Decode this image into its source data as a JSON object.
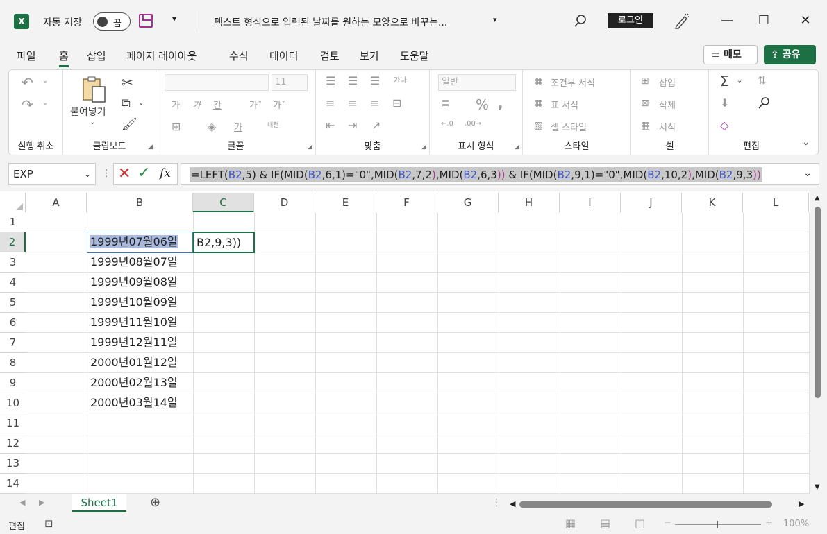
{
  "app": {
    "autosave_label": "자동 저장",
    "autosave_state": "끔",
    "doc_title": "텍스트 형식으로 입력된 날짜를 원하는 모양으로 바꾸는...",
    "login_label": "로그인"
  },
  "menu": {
    "items": [
      "파일",
      "홈",
      "삽입",
      "페이지 레이아웃",
      "수식",
      "데이터",
      "검토",
      "보기",
      "도움말"
    ],
    "active": "홈",
    "memo_label": "메모",
    "share_label": "공유"
  },
  "ribbon": {
    "undo_label": "실행 취소",
    "paste_label": "붙여넣기",
    "clipboard_label": "클립보드",
    "font_label": "글꼴",
    "font_size": "11",
    "align_label": "맞춤",
    "number_format": "일반",
    "number_label": "표시 형식",
    "cond_format": "조건부 서식",
    "table_format": "표 서식",
    "cell_style": "셀 스타일",
    "style_label": "스타일",
    "insert": "삽입",
    "delete": "삭제",
    "format": "서식",
    "cells_label": "셀",
    "edit_label": "편집"
  },
  "formula_bar": {
    "name_box": "EXP",
    "fx": "fx",
    "formula_parts": [
      {
        "t": "=LEFT(",
        "c": ""
      },
      {
        "t": "B2",
        "c": "ref"
      },
      {
        "t": ",5) & IF(MID(",
        "c": ""
      },
      {
        "t": "B2",
        "c": "ref"
      },
      {
        "t": ",6,1)=\"0\",MID(",
        "c": ""
      },
      {
        "t": "B2",
        "c": "ref"
      },
      {
        "t": ",7,2",
        "c": ""
      },
      {
        "t": ")",
        "c": "paren"
      },
      {
        "t": ",MID(",
        "c": ""
      },
      {
        "t": "B2",
        "c": "ref"
      },
      {
        "t": ",6,3",
        "c": ""
      },
      {
        "t": "))",
        "c": "paren"
      },
      {
        "t": " & IF(MID(",
        "c": ""
      },
      {
        "t": "B2",
        "c": "ref"
      },
      {
        "t": ",9,1)=\"0\",MID(",
        "c": ""
      },
      {
        "t": "B2",
        "c": "ref"
      },
      {
        "t": ",10,2",
        "c": ""
      },
      {
        "t": ")",
        "c": "paren"
      },
      {
        "t": ",MID(",
        "c": ""
      },
      {
        "t": "B2",
        "c": "ref"
      },
      {
        "t": ",9,3",
        "c": ""
      },
      {
        "t": "))",
        "c": "paren"
      }
    ]
  },
  "grid": {
    "columns": [
      "A",
      "B",
      "C",
      "D",
      "E",
      "F",
      "G",
      "H",
      "I",
      "J",
      "K",
      "L"
    ],
    "rows": [
      "1",
      "2",
      "3",
      "4",
      "5",
      "6",
      "7",
      "8",
      "9",
      "10",
      "11",
      "12",
      "13",
      "14"
    ],
    "col_b_values": [
      "",
      "1999년07월06일",
      "1999년08월07일",
      "1999년09월08일",
      "1999년10월09일",
      "1999년11월10일",
      "1999년12월11일",
      "2000년01월12일",
      "2000년02월13일",
      "2000년03월14일"
    ],
    "c2_edit_text": "B2,9,3))"
  },
  "sheets": {
    "tabs": [
      "Sheet1"
    ]
  },
  "status": {
    "mode": "편집",
    "zoom": "100%"
  },
  "colors": {
    "accent": "#1d7044",
    "ref": "#3b54c4",
    "paren": "#a33d8c"
  }
}
